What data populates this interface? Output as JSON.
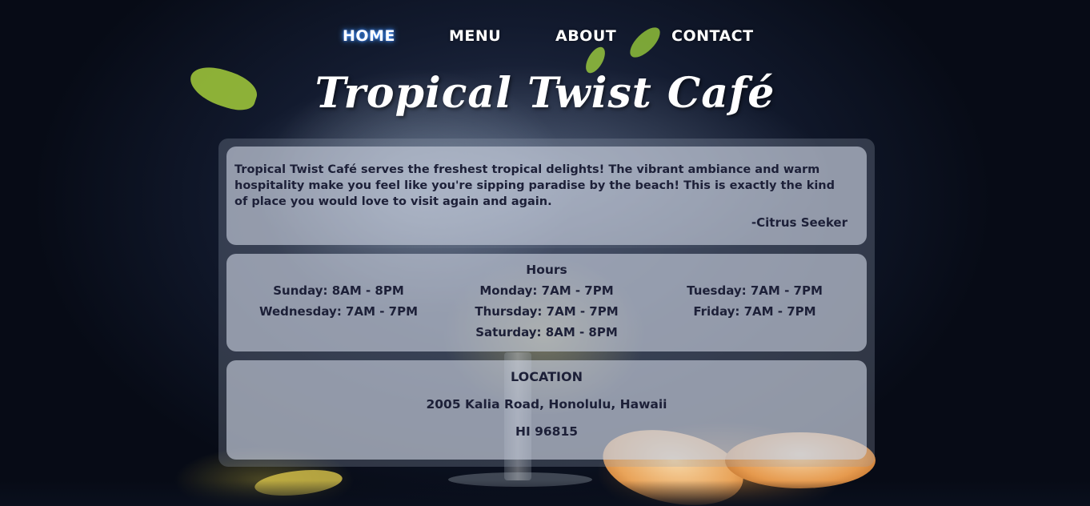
{
  "nav": {
    "items": [
      {
        "label": "HOME",
        "active": true
      },
      {
        "label": "MENU",
        "active": false
      },
      {
        "label": "ABOUT",
        "active": false
      },
      {
        "label": "CONTACT",
        "active": false
      }
    ]
  },
  "site": {
    "title": "Tropical Twist Café"
  },
  "review": {
    "text": "Tropical Twist Café serves the freshest tropical delights! The vibrant ambiance and warm hospitality make you feel like you're sipping paradise by the beach! This is exactly the kind of place you would love to visit again and again.",
    "author": "-Citrus Seeker"
  },
  "hours": {
    "title": "Hours",
    "entries": [
      "Sunday: 8AM - 8PM",
      "Monday: 7AM - 7PM",
      "Tuesday: 7AM - 7PM",
      "Wednesday: 7AM - 7PM",
      "Thursday: 7AM - 7PM",
      "Friday: 7AM - 7PM",
      "Saturday: 8AM - 8PM"
    ]
  },
  "location": {
    "title": "LOCATION",
    "address_line1": "2005 Kalia Road, Honolulu, Hawaii",
    "address_line2": "HI 96815"
  },
  "colors": {
    "nav_active_glow": "#4aa0ff",
    "card_text": "#1d2038",
    "title_text": "#ffffff"
  }
}
